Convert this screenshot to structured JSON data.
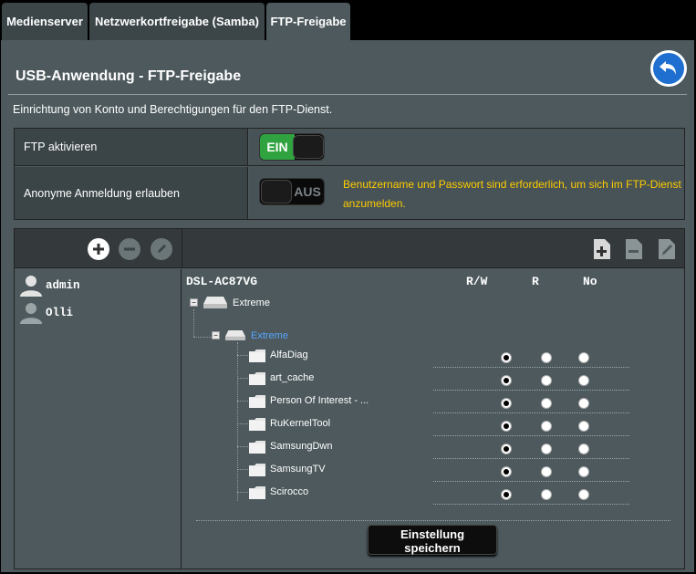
{
  "tabs": [
    {
      "label": "Medienserver",
      "active": false
    },
    {
      "label": "Netzwerkortfreigabe (Samba)",
      "active": false
    },
    {
      "label": "FTP-Freigabe",
      "active": true
    }
  ],
  "page": {
    "title": "USB-Anwendung - FTP-Freigabe",
    "description": "Einrichtung von Konto und Berechtigungen für den FTP-Dienst."
  },
  "settings": {
    "ftp_enable": {
      "label": "FTP aktivieren",
      "state": "EIN"
    },
    "anonymous": {
      "label": "Anonyme Anmeldung erlauben",
      "state": "AUS",
      "hint": "Benutzername und Passwort sind erforderlich, um sich im FTP-Dienst anzumelden."
    }
  },
  "users": [
    {
      "name": "admin"
    },
    {
      "name": "Olli"
    }
  ],
  "tree": {
    "device": "DSL-AC87VG",
    "columns": [
      "R/W",
      "R",
      "No"
    ],
    "drive": "Extreme",
    "partition": "Extreme",
    "folders": [
      {
        "name": "AlfaDiag",
        "permission": "R/W"
      },
      {
        "name": "art_cache",
        "permission": "R/W"
      },
      {
        "name": "Person Of Interest - ...",
        "permission": "R/W"
      },
      {
        "name": "RuKernelTool",
        "permission": "R/W"
      },
      {
        "name": "SamsungDwn",
        "permission": "R/W"
      },
      {
        "name": "SamsungTV",
        "permission": "R/W"
      },
      {
        "name": "Scirocco",
        "permission": "R/W"
      }
    ]
  },
  "save_button": {
    "line1": "Einstellung",
    "line2": "speichern"
  },
  "colors": {
    "accent_on": "#2fa33f",
    "hint": "#ffcc00",
    "link": "#57a6ff",
    "back_button": "#1e6fd0"
  }
}
